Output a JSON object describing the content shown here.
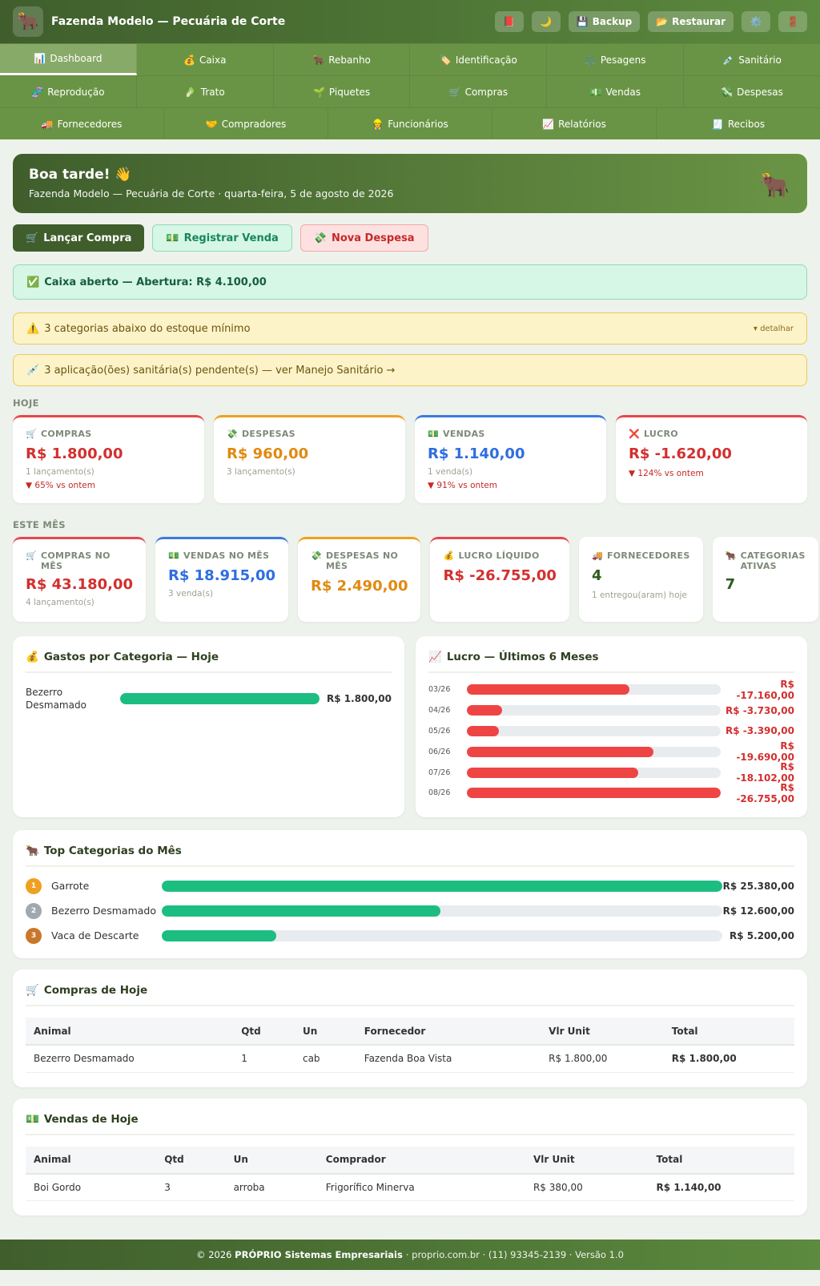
{
  "header": {
    "title": "Fazenda Modelo — Pecuária de Corte",
    "logo": "🐂",
    "buttons": {
      "book": "📕",
      "theme": "🌙",
      "backup_icon": "💾",
      "backup": "Backup",
      "restore_icon": "📂",
      "restore": "Restaurar",
      "settings": "⚙️",
      "exit": "🚪"
    }
  },
  "nav": {
    "row1": [
      {
        "icon": "📊",
        "label": "Dashboard"
      },
      {
        "icon": "💰",
        "label": "Caixa"
      },
      {
        "icon": "🐂",
        "label": "Rebanho"
      },
      {
        "icon": "🏷️",
        "label": "Identificação"
      },
      {
        "icon": "⚖️",
        "label": "Pesagens"
      },
      {
        "icon": "💉",
        "label": "Sanitário"
      }
    ],
    "row2": [
      {
        "icon": "🧬",
        "label": "Reprodução"
      },
      {
        "icon": "🥬",
        "label": "Trato"
      },
      {
        "icon": "🌱",
        "label": "Piquetes"
      },
      {
        "icon": "🛒",
        "label": "Compras"
      },
      {
        "icon": "💵",
        "label": "Vendas"
      },
      {
        "icon": "💸",
        "label": "Despesas"
      }
    ],
    "row3": [
      {
        "icon": "🚚",
        "label": "Fornecedores"
      },
      {
        "icon": "🤝",
        "label": "Compradores"
      },
      {
        "icon": "👷",
        "label": "Funcionários"
      },
      {
        "icon": "📈",
        "label": "Relatórios"
      },
      {
        "icon": "🧾",
        "label": "Recibos"
      }
    ]
  },
  "hero": {
    "greeting": "Boa tarde! 👋",
    "subtitle": "Fazenda Modelo — Pecuária de Corte · quarta-feira, 5 de agosto de 2026",
    "icon": "🐂"
  },
  "actions": {
    "buy_icon": "🛒",
    "buy": "Lançar Compra",
    "sale_icon": "💵",
    "sale": "Registrar Venda",
    "expense_icon": "💸",
    "expense": "Nova Despesa"
  },
  "alerts": {
    "cash_icon": "✅",
    "cash": "Caixa aberto — Abertura: R$ 4.100,00",
    "stock_icon": "⚠️",
    "stock": "3 categorias abaixo do estoque mínimo",
    "stock_more": "▾ detalhar",
    "sanitary_icon": "💉",
    "sanitary": "3 aplicação(ões) sanitária(s) pendente(s) — ver Manejo Sanitário →"
  },
  "today": {
    "label": "HOJE",
    "cards": [
      {
        "icon": "🛒",
        "label": "COMPRAS",
        "value": "R$ 1.800,00",
        "sub": "1 lançamento(s)",
        "delta": "▼ 65% vs ontem"
      },
      {
        "icon": "💸",
        "label": "DESPESAS",
        "value": "R$ 960,00",
        "sub": "3 lançamento(s)",
        "delta": ""
      },
      {
        "icon": "💵",
        "label": "VENDAS",
        "value": "R$ 1.140,00",
        "sub": "1 venda(s)",
        "delta": "▼ 91% vs ontem"
      },
      {
        "icon": "❌",
        "label": "LUCRO",
        "value": "R$ -1.620,00",
        "sub": "",
        "delta": "▼ 124% vs ontem"
      }
    ]
  },
  "month": {
    "label": "ESTE MÊS",
    "cards": [
      {
        "icon": "🛒",
        "label": "COMPRAS NO MÊS",
        "value": "R$ 43.180,00",
        "sub": "4 lançamento(s)"
      },
      {
        "icon": "💵",
        "label": "VENDAS NO MÊS",
        "value": "R$ 18.915,00",
        "sub": "3 venda(s)"
      },
      {
        "icon": "💸",
        "label": "DESPESAS NO MÊS",
        "value": "R$ 2.490,00",
        "sub": ""
      },
      {
        "icon": "💰",
        "label": "LUCRO LÍQUIDO",
        "value": "R$ -26.755,00",
        "sub": ""
      },
      {
        "icon": "🚚",
        "label": "FORNECEDORES",
        "value": "4",
        "sub": "1 entregou(aram) hoje"
      },
      {
        "icon": "🐂",
        "label": "CATEGORIAS ATIVAS",
        "value": "7",
        "sub": ""
      }
    ]
  },
  "gastos": {
    "icon": "💰",
    "title": "Gastos por Categoria — Hoje",
    "rows": [
      {
        "label": "Bezerro Desmamado",
        "value": "R$ 1.800,00",
        "fraction": 1.0
      }
    ]
  },
  "lucro": {
    "icon": "📈",
    "title": "Lucro — Últimos 6 Meses",
    "rows": [
      {
        "month": "03/26",
        "value": "R$ -17.160,00",
        "amount": -17160
      },
      {
        "month": "04/26",
        "value": "R$ -3.730,00",
        "amount": -3730
      },
      {
        "month": "05/26",
        "value": "R$ -3.390,00",
        "amount": -3390
      },
      {
        "month": "06/26",
        "value": "R$ -19.690,00",
        "amount": -19690
      },
      {
        "month": "07/26",
        "value": "R$ -18.102,00",
        "amount": -18102
      },
      {
        "month": "08/26",
        "value": "R$ -26.755,00",
        "amount": -26755
      }
    ]
  },
  "top": {
    "icon": "🐂",
    "title": "Top Categorias do Mês",
    "rows": [
      {
        "rank": "1",
        "label": "Garrote",
        "value": "R$ 25.380,00",
        "amount": 25380
      },
      {
        "rank": "2",
        "label": "Bezerro Desmamado",
        "value": "R$ 12.600,00",
        "amount": 12600
      },
      {
        "rank": "3",
        "label": "Vaca de Descarte",
        "value": "R$ 5.200,00",
        "amount": 5200
      }
    ]
  },
  "compras": {
    "icon": "🛒",
    "title": "Compras de Hoje",
    "headers": [
      "Animal",
      "Qtd",
      "Un",
      "Fornecedor",
      "Vlr Unit",
      "Total"
    ],
    "rows": [
      [
        "Bezerro Desmamado",
        "1",
        "cab",
        "Fazenda Boa Vista",
        "R$ 1.800,00",
        "R$ 1.800,00"
      ]
    ]
  },
  "vendas": {
    "icon": "💵",
    "title": "Vendas de Hoje",
    "headers": [
      "Animal",
      "Qtd",
      "Un",
      "Comprador",
      "Vlr Unit",
      "Total"
    ],
    "rows": [
      [
        "Boi Gordo",
        "3",
        "arroba",
        "Frigorífico Minerva",
        "R$ 380,00",
        "R$ 1.140,00"
      ]
    ]
  },
  "footer": {
    "copyright": "© 2026",
    "company": "PRÓPRIO Sistemas Empresariais",
    "info": "· proprio.com.br · (11) 93345-2139 · Versão 1.0"
  }
}
